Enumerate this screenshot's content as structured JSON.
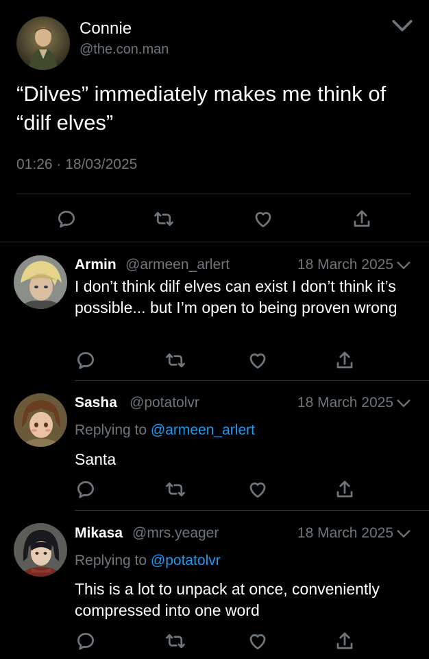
{
  "main_tweet": {
    "author_name": "Connie",
    "handle": "@the.con.man",
    "text": "“Dilves” immediately makes me think of “dilf elves”",
    "time": "01:26",
    "date": "18/03/2025"
  },
  "replies": [
    {
      "author_name": "Armin",
      "handle": "@armeen_arlert",
      "date": "18 March 2025",
      "replying_to_prefix": "",
      "replying_to": "",
      "text": "I don’t think dilf elves can exist I don’t think it’s possible... but I’m open to being proven wrong"
    },
    {
      "author_name": "Sasha",
      "handle": "@potatolvr",
      "date": "18 March 2025",
      "replying_to_prefix": "Replying to",
      "replying_to": "@armeen_arlert",
      "text": "Santa"
    },
    {
      "author_name": "Mikasa",
      "handle": "@mrs.yeager",
      "date": "18 March 2025",
      "replying_to_prefix": "Replying to",
      "replying_to": "@potatolvr",
      "text": "This is a lot to unpack at once, conveniently compressed into one word"
    }
  ],
  "icons": [
    "reply-icon",
    "retweet-icon",
    "like-icon",
    "share-icon",
    "chevron-down-icon"
  ],
  "colors": {
    "background": "#000000",
    "primary_text": "#ffffff",
    "secondary_text": "#6e767d",
    "link": "#1d9bf0",
    "divider": "#2f3336"
  }
}
